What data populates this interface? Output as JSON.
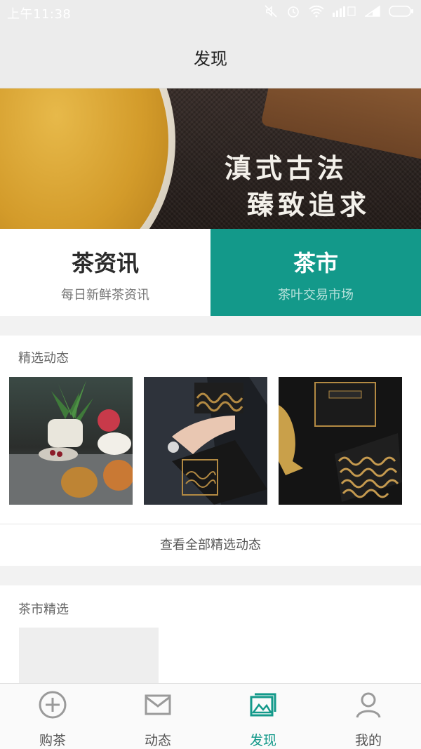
{
  "status_bar": {
    "time": "上午11:38"
  },
  "header": {
    "title": "发现"
  },
  "banner": {
    "line1": "滇式古法",
    "line2": "臻致追求"
  },
  "tiles": [
    {
      "title": "茶资讯",
      "subtitle": "每日新鲜茶资讯"
    },
    {
      "title": "茶市",
      "subtitle": "茶叶交易市场"
    }
  ],
  "featured": {
    "title": "精选动态",
    "view_all": "查看全部精选动态"
  },
  "market": {
    "title": "茶市精选"
  },
  "tabbar": {
    "items": [
      {
        "label": "购茶",
        "icon": "plus-circle-icon"
      },
      {
        "label": "动态",
        "icon": "envelope-icon"
      },
      {
        "label": "发现",
        "icon": "gallery-icon"
      },
      {
        "label": "我的",
        "icon": "user-icon"
      }
    ],
    "active": "发现"
  },
  "colors": {
    "accent": "#13998a"
  }
}
